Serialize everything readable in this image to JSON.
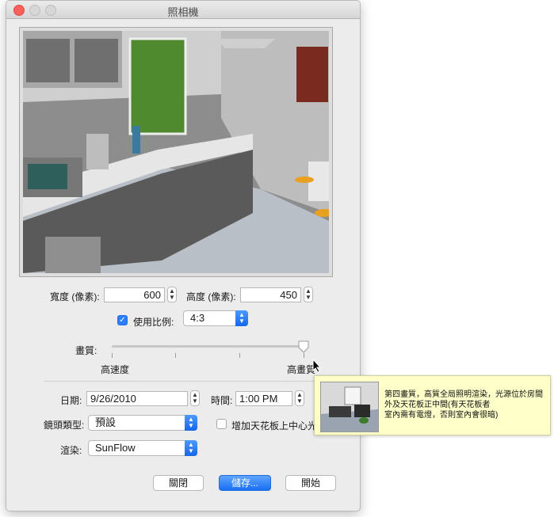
{
  "window": {
    "title": "照相機"
  },
  "size": {
    "width_label": "寬度 (像素):",
    "width_value": "600",
    "height_label": "高度 (像素):",
    "height_value": "450"
  },
  "ratio": {
    "checkbox_label": "使用比例:",
    "checked": true,
    "selected": "4:3"
  },
  "quality": {
    "label": "畫質:",
    "low_label": "高速度",
    "high_label": "高畫質",
    "level_index": 3,
    "levels": 4
  },
  "datetime": {
    "date_label": "日期:",
    "date_value": "9/26/2010",
    "time_label": "時間:",
    "time_value": "1:00 PM"
  },
  "lens": {
    "label": "鏡頭類型:",
    "selected": "預設"
  },
  "ceiling_light": {
    "label": "增加天花板上中心光源",
    "checked": false
  },
  "render": {
    "label": "渲染:",
    "selected": "SunFlow"
  },
  "buttons": {
    "close": "關閉",
    "save": "儲存...",
    "start": "開始"
  },
  "tooltip": {
    "line1": "第四畫質，高質全局照明渲染，光源位於房間",
    "line2": "外及天花板正中間(有天花板者",
    "line3": "室內需有電燈，否則室內會很暗)"
  },
  "colors": {
    "accent": "#2d7ff9",
    "tooltip_bg": "#ffffc9",
    "close_traffic": "#fc605b"
  }
}
